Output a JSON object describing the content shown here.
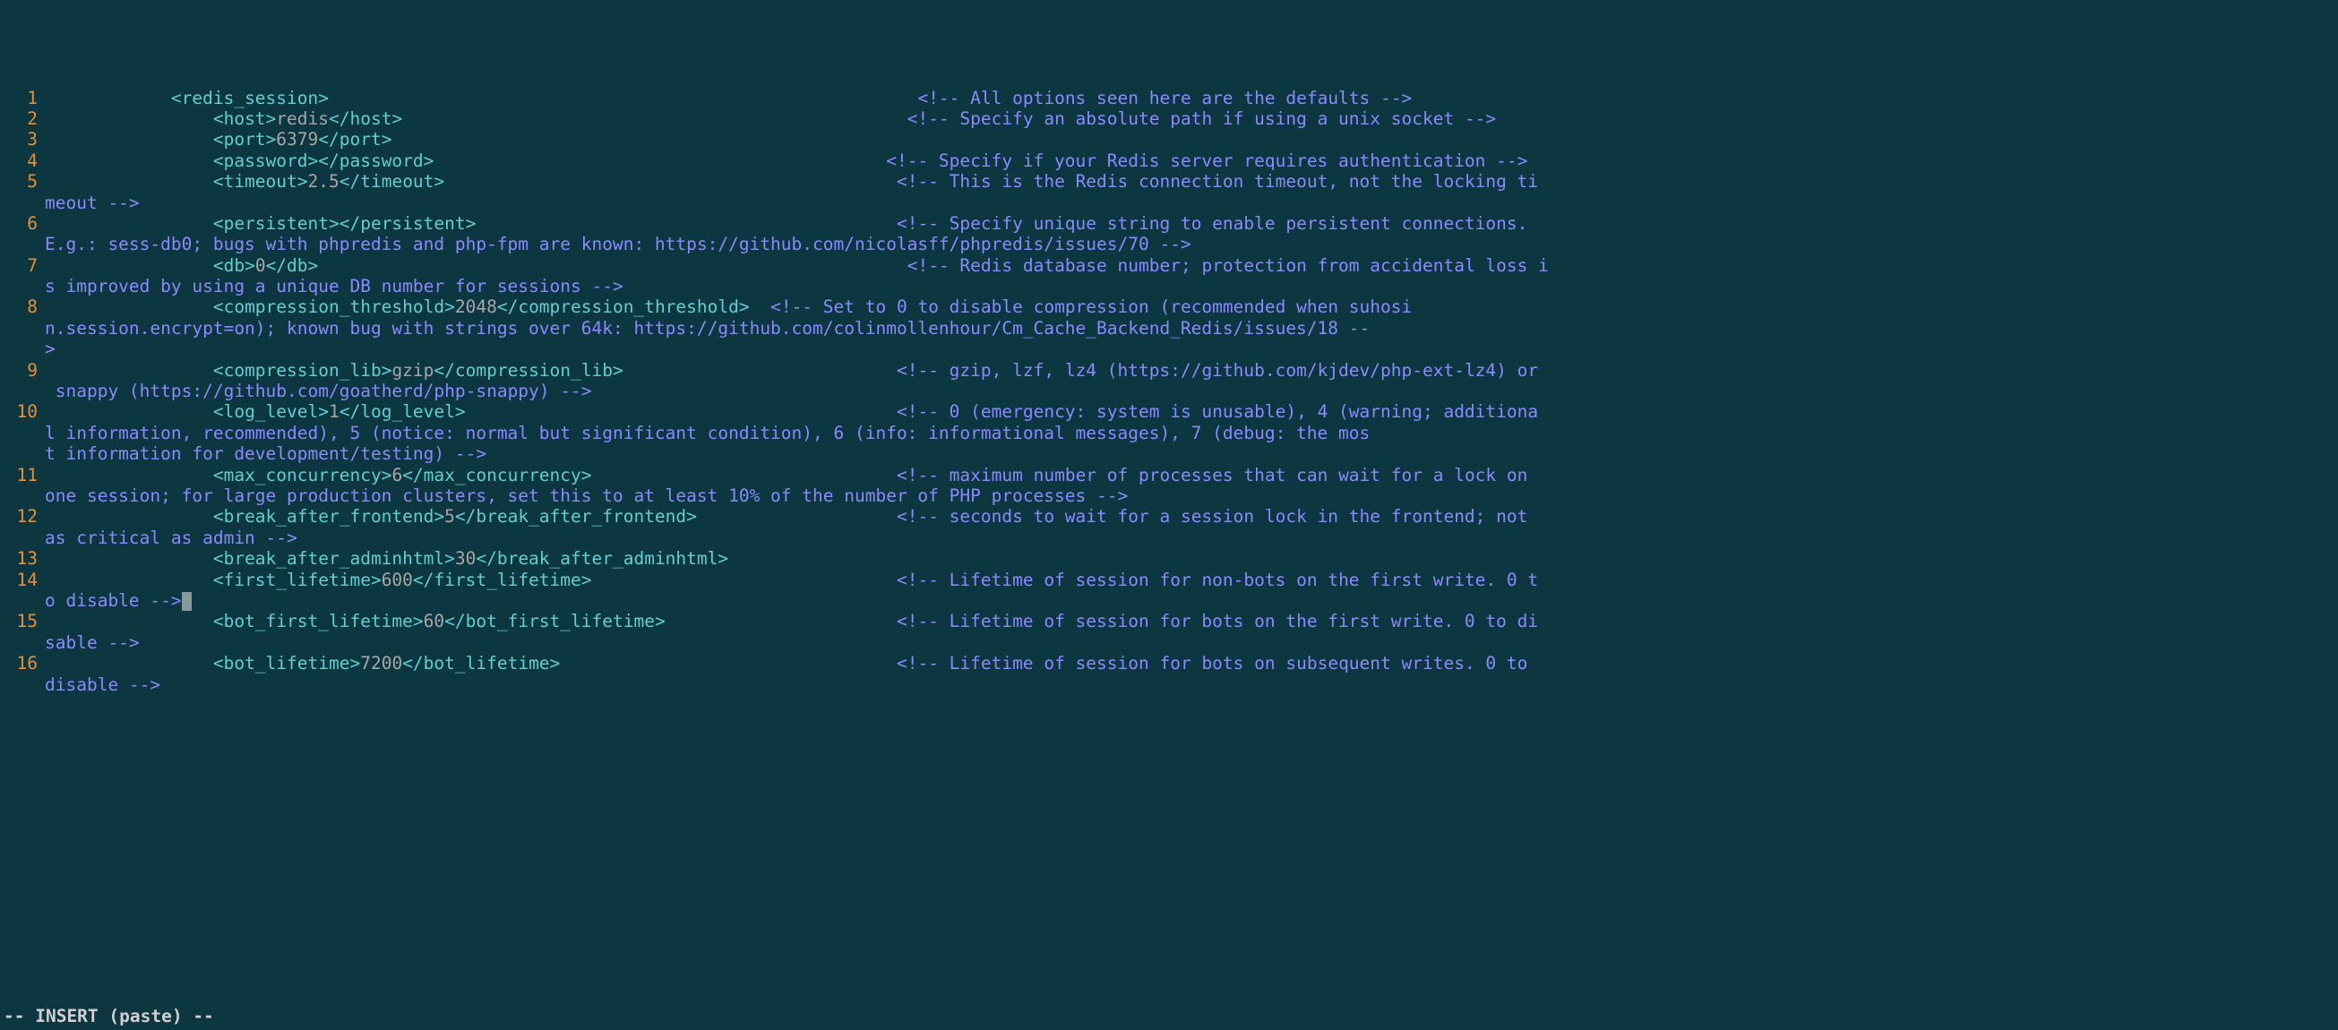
{
  "status_line": "-- INSERT (paste) --",
  "lines": [
    {
      "num": "1",
      "rows": [
        [
          {
            "t": "            "
          },
          {
            "t": "<redis_session>",
            "c": "tag"
          },
          {
            "t": "                                                        "
          },
          {
            "t": "<!-- All options seen here are the defaults -->",
            "c": "comment"
          }
        ]
      ]
    },
    {
      "num": "2",
      "rows": [
        [
          {
            "t": "                "
          },
          {
            "t": "<host>",
            "c": "tag"
          },
          {
            "t": "redis",
            "c": "val"
          },
          {
            "t": "</host>",
            "c": "tag"
          },
          {
            "t": "                                                "
          },
          {
            "t": "<!-- Specify an absolute path if using a unix socket -->",
            "c": "comment"
          }
        ]
      ]
    },
    {
      "num": "3",
      "rows": [
        [
          {
            "t": "                "
          },
          {
            "t": "<port>",
            "c": "tag"
          },
          {
            "t": "6379",
            "c": "val"
          },
          {
            "t": "</port>",
            "c": "tag"
          }
        ]
      ]
    },
    {
      "num": "4",
      "rows": [
        [
          {
            "t": "                "
          },
          {
            "t": "<password>",
            "c": "tag"
          },
          {
            "t": "</password>",
            "c": "tag"
          },
          {
            "t": "                                           "
          },
          {
            "t": "<!-- Specify if your Redis server requires authentication -->",
            "c": "comment"
          }
        ]
      ]
    },
    {
      "num": "5",
      "rows": [
        [
          {
            "t": "                "
          },
          {
            "t": "<timeout>",
            "c": "tag"
          },
          {
            "t": "2.5",
            "c": "val"
          },
          {
            "t": "</timeout>",
            "c": "tag"
          },
          {
            "t": "                                           "
          },
          {
            "t": "<!-- This is the Redis connection timeout, not the locking ti",
            "c": "comment"
          }
        ],
        [
          {
            "t": "meout -->",
            "c": "comment"
          }
        ]
      ]
    },
    {
      "num": "6",
      "rows": [
        [
          {
            "t": "                "
          },
          {
            "t": "<persistent>",
            "c": "tag"
          },
          {
            "t": "</persistent>",
            "c": "tag"
          },
          {
            "t": "                                        "
          },
          {
            "t": "<!-- Specify unique string to enable persistent connections. ",
            "c": "comment"
          }
        ],
        [
          {
            "t": "E.g.: sess-db0; bugs with phpredis and php-fpm are known: https://github.com/nicolasff/phpredis/issues/70 -->",
            "c": "comment"
          }
        ]
      ]
    },
    {
      "num": "7",
      "rows": [
        [
          {
            "t": "                "
          },
          {
            "t": "<db>",
            "c": "tag"
          },
          {
            "t": "0",
            "c": "val"
          },
          {
            "t": "</db>",
            "c": "tag"
          },
          {
            "t": "                                                        "
          },
          {
            "t": "<!-- Redis database number; protection from accidental loss i",
            "c": "comment"
          }
        ],
        [
          {
            "t": "s improved by using a unique DB number for sessions -->",
            "c": "comment"
          }
        ]
      ]
    },
    {
      "num": "8",
      "rows": [
        [
          {
            "t": "                "
          },
          {
            "t": "<compression_threshold>",
            "c": "tag"
          },
          {
            "t": "2048",
            "c": "val"
          },
          {
            "t": "</compression_threshold>",
            "c": "tag"
          },
          {
            "t": "  "
          },
          {
            "t": "<!-- Set to 0 to disable compression (recommended when suhosi",
            "c": "comment"
          }
        ],
        [
          {
            "t": "n.session.encrypt=on); known bug with strings over 64k: https://github.com/colinmollenhour/Cm_Cache_Backend_Redis/issues/18 --",
            "c": "comment"
          }
        ],
        [
          {
            "t": ">",
            "c": "comment"
          }
        ]
      ]
    },
    {
      "num": "9",
      "rows": [
        [
          {
            "t": "                "
          },
          {
            "t": "<compression_lib>",
            "c": "tag"
          },
          {
            "t": "gzip",
            "c": "val"
          },
          {
            "t": "</compression_lib>",
            "c": "tag"
          },
          {
            "t": "                          "
          },
          {
            "t": "<!-- gzip, lzf, lz4 (https://github.com/kjdev/php-ext-lz4) or",
            "c": "comment"
          }
        ],
        [
          {
            "t": " snappy (https://github.com/goatherd/php-snappy) -->",
            "c": "comment"
          }
        ]
      ]
    },
    {
      "num": "10",
      "rows": [
        [
          {
            "t": "                "
          },
          {
            "t": "<log_level>",
            "c": "tag"
          },
          {
            "t": "1",
            "c": "val"
          },
          {
            "t": "</log_level>",
            "c": "tag"
          },
          {
            "t": "                                         "
          },
          {
            "t": "<!-- 0 (emergency: system is unusable), 4 (warning; additiona",
            "c": "comment"
          }
        ],
        [
          {
            "t": "l information, recommended), 5 (notice: normal but significant condition), 6 (info: informational messages), 7 (debug: the mos",
            "c": "comment"
          }
        ],
        [
          {
            "t": "t information for development/testing) -->",
            "c": "comment"
          }
        ]
      ]
    },
    {
      "num": "11",
      "rows": [
        [
          {
            "t": "                "
          },
          {
            "t": "<max_concurrency>",
            "c": "tag"
          },
          {
            "t": "6",
            "c": "val"
          },
          {
            "t": "</max_concurrency>",
            "c": "tag"
          },
          {
            "t": "                             "
          },
          {
            "t": "<!-- maximum number of processes that can wait for a lock on ",
            "c": "comment"
          }
        ],
        [
          {
            "t": "one session; for large production clusters, set this to at least 10% of the number of PHP processes -->",
            "c": "comment"
          }
        ]
      ]
    },
    {
      "num": "12",
      "rows": [
        [
          {
            "t": "                "
          },
          {
            "t": "<break_after_frontend>",
            "c": "tag"
          },
          {
            "t": "5",
            "c": "val"
          },
          {
            "t": "</break_after_frontend>",
            "c": "tag"
          },
          {
            "t": "                   "
          },
          {
            "t": "<!-- seconds to wait for a session lock in the frontend; not ",
            "c": "comment"
          }
        ],
        [
          {
            "t": "as critical as admin -->",
            "c": "comment"
          }
        ]
      ]
    },
    {
      "num": "13",
      "rows": [
        [
          {
            "t": "                "
          },
          {
            "t": "<break_after_adminhtml>",
            "c": "tag"
          },
          {
            "t": "30",
            "c": "val"
          },
          {
            "t": "</break_after_adminhtml>",
            "c": "tag"
          }
        ]
      ]
    },
    {
      "num": "14",
      "cursor_row": 1,
      "rows": [
        [
          {
            "t": "                "
          },
          {
            "t": "<first_lifetime>",
            "c": "tag"
          },
          {
            "t": "600",
            "c": "val"
          },
          {
            "t": "</first_lifetime>",
            "c": "tag"
          },
          {
            "t": "                             "
          },
          {
            "t": "<!-- Lifetime of session for non-bots on the first write. 0 t",
            "c": "comment"
          }
        ],
        [
          {
            "t": "o disable -->",
            "c": "comment"
          }
        ]
      ]
    },
    {
      "num": "15",
      "rows": [
        [
          {
            "t": "                "
          },
          {
            "t": "<bot_first_lifetime>",
            "c": "tag"
          },
          {
            "t": "60",
            "c": "val"
          },
          {
            "t": "</bot_first_lifetime>",
            "c": "tag"
          },
          {
            "t": "                      "
          },
          {
            "t": "<!-- Lifetime of session for bots on the first write. 0 to di",
            "c": "comment"
          }
        ],
        [
          {
            "t": "sable -->",
            "c": "comment"
          }
        ]
      ]
    },
    {
      "num": "16",
      "rows": [
        [
          {
            "t": "                "
          },
          {
            "t": "<bot_lifetime>",
            "c": "tag"
          },
          {
            "t": "7200",
            "c": "val"
          },
          {
            "t": "</bot_lifetime>",
            "c": "tag"
          },
          {
            "t": "                                "
          },
          {
            "t": "<!-- Lifetime of session for bots on subsequent writes. 0 to ",
            "c": "comment"
          }
        ],
        [
          {
            "t": "disable -->",
            "c": "comment"
          }
        ]
      ]
    }
  ]
}
